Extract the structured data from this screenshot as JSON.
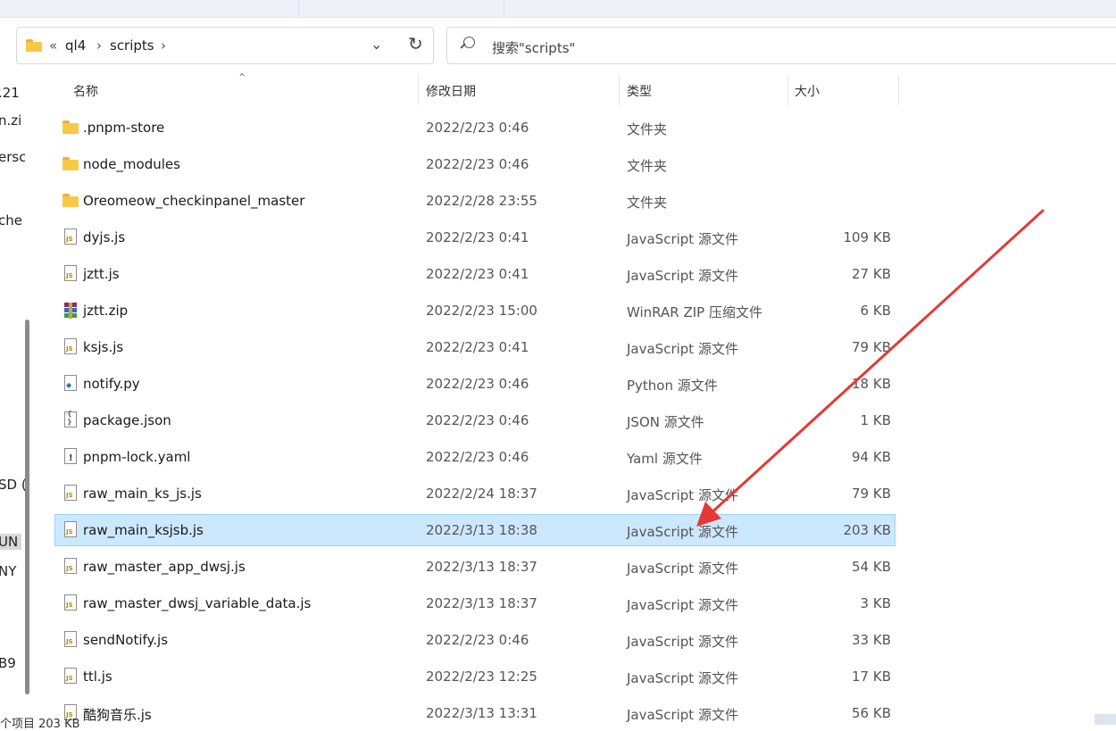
{
  "breadcrumb": {
    "overflow": "«",
    "items": [
      "ql4",
      "scripts"
    ],
    "separator": "›"
  },
  "search": {
    "placeholder": "搜索\"scripts\""
  },
  "left_nav": {
    "fragments": [
      ".21",
      "n.zi",
      "ersc",
      "che",
      "SD (",
      "UN",
      "NY",
      "B9"
    ]
  },
  "columns": {
    "name": "名称",
    "date": "修改日期",
    "type": "类型",
    "size": "大小"
  },
  "files": [
    {
      "name": ".pnpm-store",
      "date": "2022/2/23 0:46",
      "type": "文件夹",
      "size": "",
      "icon": "folder-icon",
      "kind": "folder"
    },
    {
      "name": "node_modules",
      "date": "2022/2/23 0:46",
      "type": "文件夹",
      "size": "",
      "icon": "folder-icon",
      "kind": "folder"
    },
    {
      "name": "Oreomeow_checkinpanel_master",
      "date": "2022/2/28 23:55",
      "type": "文件夹",
      "size": "",
      "icon": "folder-icon",
      "kind": "folder"
    },
    {
      "name": "dyjs.js",
      "date": "2022/2/23 0:41",
      "type": "JavaScript 源文件",
      "size": "109 KB",
      "icon": "js-file-icon",
      "kind": "js"
    },
    {
      "name": "jztt.js",
      "date": "2022/2/23 0:41",
      "type": "JavaScript 源文件",
      "size": "27 KB",
      "icon": "js-file-icon",
      "kind": "js"
    },
    {
      "name": "jztt.zip",
      "date": "2022/2/23 15:00",
      "type": "WinRAR ZIP 压缩文件",
      "size": "6 KB",
      "icon": "winrar-archive-icon",
      "kind": "zip"
    },
    {
      "name": "ksjs.js",
      "date": "2022/2/23 0:41",
      "type": "JavaScript 源文件",
      "size": "79 KB",
      "icon": "js-file-icon",
      "kind": "js"
    },
    {
      "name": "notify.py",
      "date": "2022/2/23 0:46",
      "type": "Python 源文件",
      "size": "18 KB",
      "icon": "python-file-icon",
      "kind": "py"
    },
    {
      "name": "package.json",
      "date": "2022/2/23 0:46",
      "type": "JSON 源文件",
      "size": "1 KB",
      "icon": "json-file-icon",
      "kind": "json"
    },
    {
      "name": "pnpm-lock.yaml",
      "date": "2022/2/23 0:46",
      "type": "Yaml 源文件",
      "size": "94 KB",
      "icon": "yaml-file-icon",
      "kind": "yaml"
    },
    {
      "name": "raw_main_ks_js.js",
      "date": "2022/2/24 18:37",
      "type": "JavaScript 源文件",
      "size": "79 KB",
      "icon": "js-file-icon",
      "kind": "js"
    },
    {
      "name": "raw_main_ksjsb.js",
      "date": "2022/3/13 18:38",
      "type": "JavaScript 源文件",
      "size": "203 KB",
      "icon": "js-file-icon",
      "kind": "js",
      "selected": true
    },
    {
      "name": "raw_master_app_dwsj.js",
      "date": "2022/3/13 18:37",
      "type": "JavaScript 源文件",
      "size": "54 KB",
      "icon": "js-file-icon",
      "kind": "js"
    },
    {
      "name": "raw_master_dwsj_variable_data.js",
      "date": "2022/3/13 18:37",
      "type": "JavaScript 源文件",
      "size": "3 KB",
      "icon": "js-file-icon",
      "kind": "js"
    },
    {
      "name": "sendNotify.js",
      "date": "2022/2/23 0:46",
      "type": "JavaScript 源文件",
      "size": "33 KB",
      "icon": "js-file-icon",
      "kind": "js"
    },
    {
      "name": "ttl.js",
      "date": "2022/2/23 12:25",
      "type": "JavaScript 源文件",
      "size": "17 KB",
      "icon": "js-file-icon",
      "kind": "js"
    },
    {
      "name": "酷狗音乐.js",
      "date": "2022/3/13 13:31",
      "type": "JavaScript 源文件",
      "size": "56 KB",
      "icon": "js-file-icon",
      "kind": "js"
    }
  ],
  "status_bar": {
    "text": "个项目  203 KB"
  },
  "colors": {
    "selection": "#cce8ff",
    "selection_border": "#99d1ff",
    "arrow": "#e53935",
    "folder": "#f7c948"
  }
}
